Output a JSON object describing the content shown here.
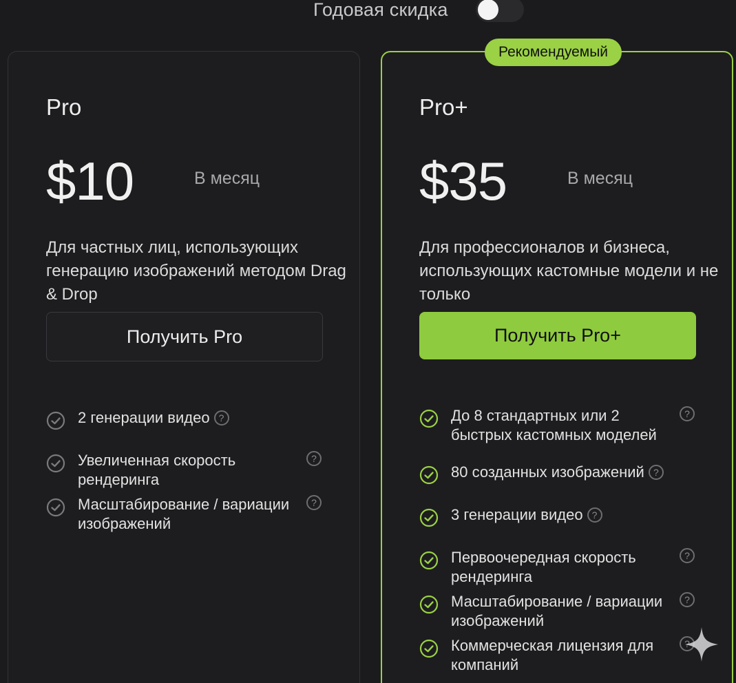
{
  "toggle": {
    "label": "Годовая скидка",
    "enabled": false
  },
  "colors": {
    "accent": "#9bd145",
    "background": "#1b1b1d",
    "check_pro": "#7a7a7e",
    "check_proplus": "#9bd145"
  },
  "plans": [
    {
      "name": "Pro",
      "price": "$10",
      "period": "В месяц",
      "description": "Для частных лиц, использующих генерацию изображений методом Drag & Drop",
      "cta": "Получить Pro",
      "features": [
        "2 генерации видео",
        "Увеличенная скорость рендеринга",
        "Масштабирование / вариации изображений"
      ]
    },
    {
      "badge": "Рекомендуемый",
      "name": "Pro+",
      "price": "$35",
      "period": "В месяц",
      "description": "Для профессионалов и бизнеса, использующих кастомные модели и не только",
      "cta": "Получить Pro+",
      "features": [
        "До 8 стандартных или 2 быстрых кастомных моделей",
        "80 созданных изображений",
        "3 генерации видео",
        "Первоочередная скорость рендеринга",
        "Масштабирование / вариации изображений",
        "Коммерческая лицензия для компаний"
      ]
    }
  ],
  "icons": {
    "check": "check-circle-icon",
    "help": "question-circle-icon",
    "corner": "sparkle-icon",
    "help_glyph": "?"
  }
}
